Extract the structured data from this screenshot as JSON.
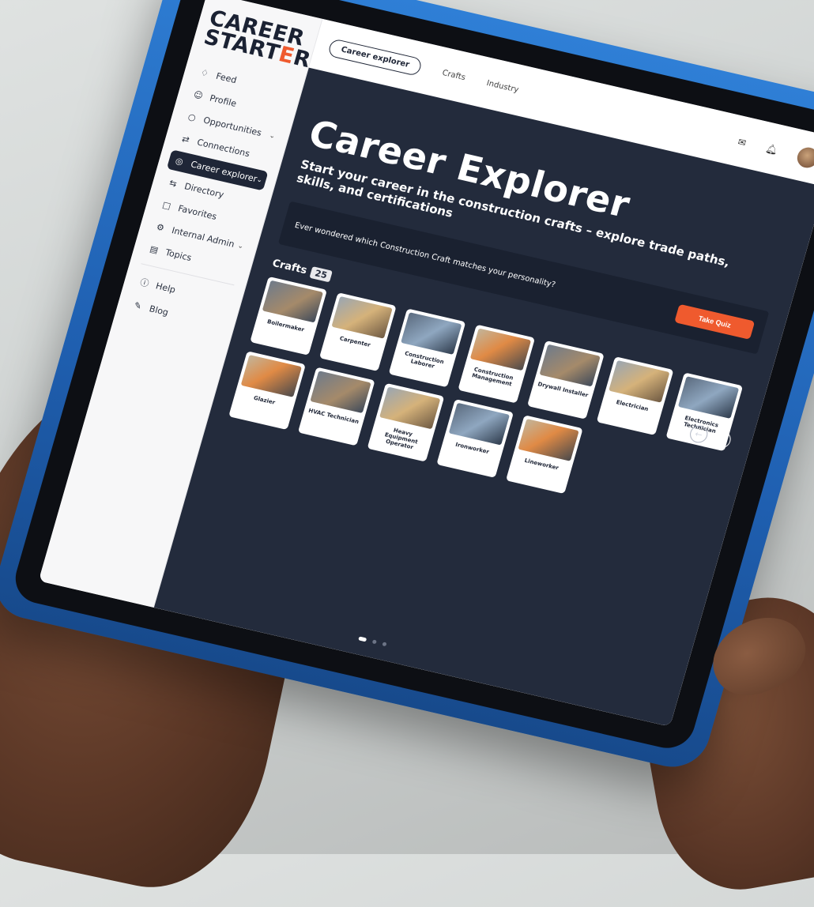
{
  "brand": {
    "line1": "CAREER",
    "line2_pre": "START",
    "line2_accent": "E",
    "line2_post": "R"
  },
  "sidebar": {
    "items": [
      {
        "label": "Feed",
        "icon": "feed-icon",
        "glyph": "♢"
      },
      {
        "label": "Profile",
        "icon": "profile-icon",
        "glyph": "☺"
      },
      {
        "label": "Opportunities",
        "icon": "opportunities-icon",
        "glyph": "○",
        "chevron": true
      },
      {
        "label": "Connections",
        "icon": "connections-icon",
        "glyph": "⇄"
      },
      {
        "label": "Career explorer",
        "icon": "career-explorer-icon",
        "glyph": "◎",
        "chevron": true,
        "active": true
      },
      {
        "label": "Directory",
        "icon": "directory-icon",
        "glyph": "⇆"
      },
      {
        "label": "Favorites",
        "icon": "favorites-icon",
        "glyph": "□"
      },
      {
        "label": "Internal Admin",
        "icon": "admin-icon",
        "glyph": "⚙",
        "chevron": true
      },
      {
        "label": "Topics",
        "icon": "topics-icon",
        "glyph": "▤"
      }
    ],
    "footer": [
      {
        "label": "Help",
        "icon": "help-icon",
        "glyph": "ⓘ"
      },
      {
        "label": "Blog",
        "icon": "blog-icon",
        "glyph": "✎"
      }
    ]
  },
  "tabs": [
    {
      "label": "Career explorer",
      "active": true
    },
    {
      "label": "Crafts"
    },
    {
      "label": "Industry"
    }
  ],
  "top_icons": [
    "mail-icon",
    "bell-icon",
    "avatar"
  ],
  "hero": {
    "title": "Career Explorer",
    "subtitle": "Start your career in the construction crafts – explore trade paths, skills, and certifications",
    "quiz_text": "Ever wondered which Construction Craft matches your personality?",
    "quiz_button": "Take Quiz"
  },
  "crafts": {
    "label": "Crafts",
    "count": "25",
    "items": [
      "Boilermaker",
      "Carpenter",
      "Construction Laborer",
      "Construction Management",
      "Drywall Installer",
      "Electrician",
      "Electronics Technician",
      "Glazier",
      "HVAC Technician",
      "Heavy Equipment Operator",
      "Ironworker",
      "Lineworker"
    ]
  },
  "colors": {
    "accent": "#ef5a2e",
    "dark": "#232b3c",
    "case": "#2f7fd6"
  }
}
